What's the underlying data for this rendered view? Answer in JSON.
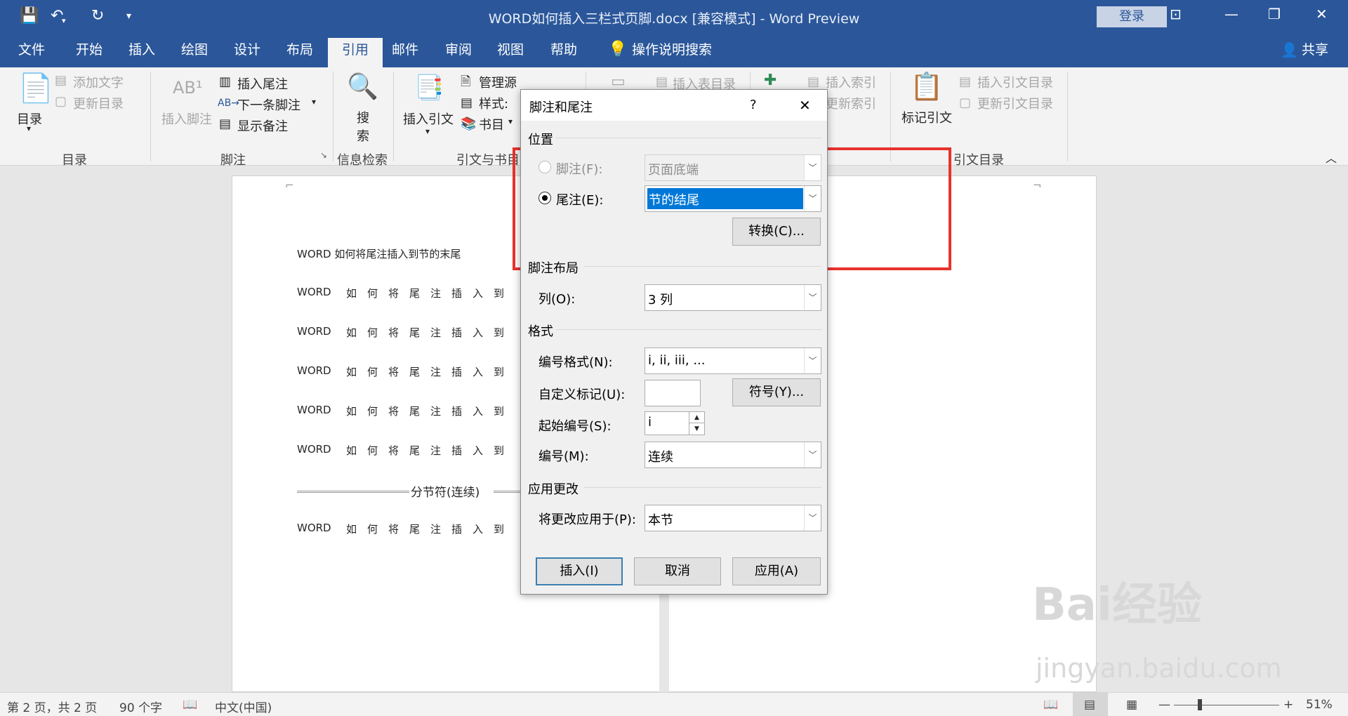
{
  "window": {
    "title": "WORD如何插入三栏式页脚.docx [兼容模式] - Word Preview",
    "login": "登录"
  },
  "tabs": [
    "文件",
    "开始",
    "插入",
    "绘图",
    "设计",
    "布局",
    "引用",
    "邮件",
    "审阅",
    "视图",
    "帮助"
  ],
  "active_tab": "引用",
  "tell_me": "操作说明搜索",
  "share": "共享",
  "ribbon": {
    "toc": {
      "big": "目录",
      "add_text": "添加文字",
      "update": "更新目录",
      "group": "目录"
    },
    "footnotes": {
      "insert_footnote": "插入脚注",
      "insert_endnote": "插入尾注",
      "next_footnote": "下一条脚注",
      "show_notes": "显示备注",
      "group": "脚注"
    },
    "research": {
      "search_a": "搜",
      "search_b": "索",
      "group": "信息检索"
    },
    "citations": {
      "insert_citation": "插入引文",
      "manage_sources": "管理源",
      "style": "样式:",
      "bibliography": "书目",
      "group": "引文与书目"
    },
    "captions": {
      "insert_table_of_figures": "插入表目录",
      "insert_index": "插入索引",
      "update_index": "更新索引"
    },
    "authorities": {
      "mark_citation": "标记引文",
      "insert_toa": "插入引文目录",
      "update_toa": "更新引文目录",
      "group": "引文目录"
    }
  },
  "document": {
    "heading": "WORD 如何将尾注插入到节的末尾",
    "line_prefix": "WORD",
    "line_text": "如何将尾注插入到",
    "section_break": "分节符(连续)"
  },
  "dialog": {
    "title": "脚注和尾注",
    "help": "?",
    "close": "✕",
    "position_section": "位置",
    "footnote_label": "脚注(F):",
    "footnote_value": "页面底端",
    "endnote_label": "尾注(E):",
    "endnote_value": "节的结尾",
    "convert_button": "转换(C)...",
    "layout_section": "脚注布局",
    "columns_label": "列(O):",
    "columns_value": "3 列",
    "format_section": "格式",
    "number_format_label": "编号格式(N):",
    "number_format_value": "i, ii, iii, ...",
    "custom_mark_label": "自定义标记(U):",
    "custom_mark_value": "",
    "symbol_button": "符号(Y)...",
    "start_at_label": "起始编号(S):",
    "start_at_value": "i",
    "numbering_label": "编号(M):",
    "numbering_value": "连续",
    "apply_section": "应用更改",
    "apply_to_label": "将更改应用于(P):",
    "apply_to_value": "本节",
    "insert_button": "插入(I)",
    "cancel_button": "取消",
    "apply_button": "应用(A)"
  },
  "status": {
    "page": "第 2 页，共 2 页",
    "words": "90 个字",
    "language": "中文(中国)",
    "zoom": "51%"
  },
  "watermark": {
    "brand": "Bai经验",
    "url": "jingyan.baidu.com"
  },
  "colors": {
    "brand": "#2b579a",
    "highlight": "#e8322d",
    "selection": "#0078d7"
  }
}
